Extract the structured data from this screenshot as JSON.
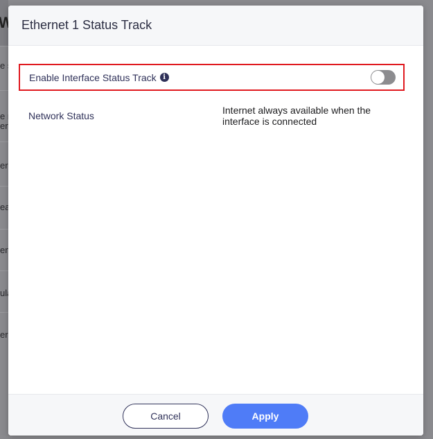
{
  "background": {
    "header_letter": "W",
    "strips": [
      {
        "text": "e s"
      },
      {
        "text": "e n"
      },
      {
        "text": "erf"
      },
      {
        "text": "ern"
      },
      {
        "text": "ea"
      },
      {
        "text": "en"
      },
      {
        "text": "ula"
      },
      {
        "text": "ern"
      }
    ],
    "footer_text": "e n"
  },
  "modal": {
    "title": "Ethernet 1 Status Track",
    "track": {
      "label": "Enable Interface Status Track",
      "info_glyph": "i",
      "enabled": false
    },
    "network_status": {
      "label": "Network Status",
      "value": "Internet always available when the interface is connected"
    },
    "footer": {
      "cancel_label": "Cancel",
      "apply_label": "Apply"
    }
  },
  "colors": {
    "accent": "#4f7cf7",
    "highlight_border": "#e0191f",
    "text_primary": "#2f3159",
    "toggle_off": "#8c8c8f"
  }
}
